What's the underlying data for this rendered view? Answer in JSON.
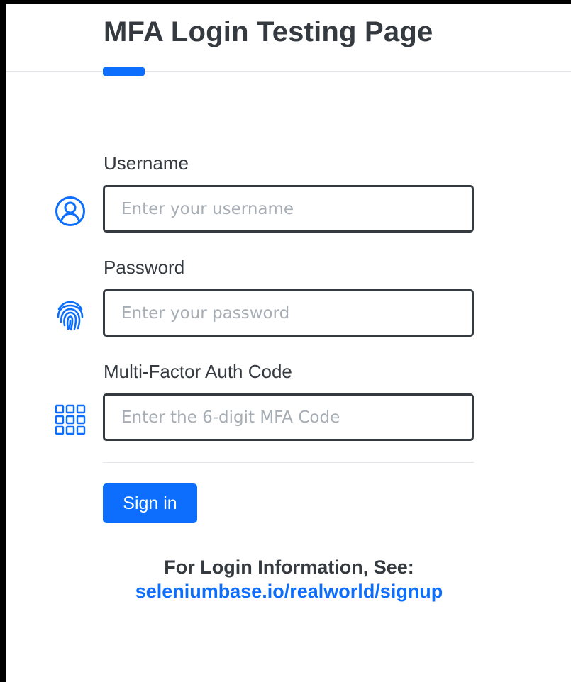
{
  "header": {
    "title": "MFA Login Testing Page"
  },
  "form": {
    "username": {
      "label": "Username",
      "placeholder": "Enter your username",
      "icon": "user-circle-icon"
    },
    "password": {
      "label": "Password",
      "placeholder": "Enter your password",
      "icon": "fingerprint-icon"
    },
    "mfa": {
      "label": "Multi-Factor Auth Code",
      "placeholder": "Enter the 6-digit MFA Code",
      "icon": "keypad-grid-icon"
    },
    "submit_label": "Sign in"
  },
  "info": {
    "heading": "For Login Information, See:",
    "link_text": "seleniumbase.io/realworld/signup"
  },
  "colors": {
    "accent": "#0d6efd",
    "text": "#343a40",
    "border": "#343a40",
    "placeholder": "#a7adb4",
    "background": "#ffffff",
    "frame": "#000000"
  }
}
